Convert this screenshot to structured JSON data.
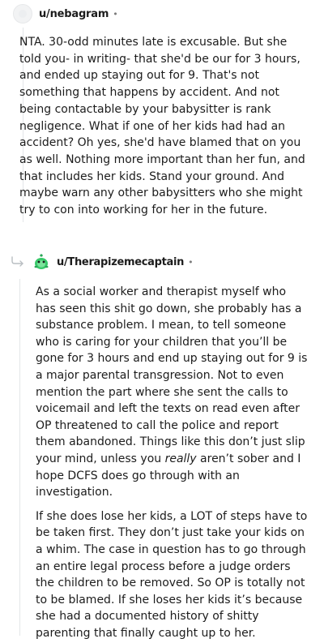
{
  "comment": {
    "username": "u/nebagram",
    "separator": "•",
    "avatar_icon": "snoo-avatar-placeholder",
    "body": "NTA. 30-odd minutes late is excusable. But she told you- in writing- that she'd be our for 3 hours, and ended up staying out for 9. That's not something that happens by accident. And not being contactable by your babysitter is rank negligence. What if one of her kids had had an accident? Oh yes, she'd have blamed that on you as well. Nothing more important than her fun, and that includes her kids. Stand your ground. And maybe warn any other babysitters who she might try to con into working for her in the future."
  },
  "reply": {
    "username": "u/Therapizemecaptain",
    "separator": "•",
    "reply_icon": "reply-arrow-icon",
    "avatar_icon": "green-snoo-avatar",
    "para1_before": "As a social worker and therapist myself who has seen this shit go down, she probably has a substance problem. I mean, to tell someone who is caring for your children that you’ll be gone for 3 hours and end up staying out for 9 is a major parental transgression. Not to even mention the part where she sent the calls to voicemail and left the texts on read even after OP threatened to call the police and report them abandoned. Things like this don’t just slip your mind, unless you ",
    "para1_em": "really",
    "para1_after": " aren’t sober and I hope DCFS does go through with an investigation.",
    "para2": "If she does lose her kids, a LOT of steps have to be taken first. They don’t just take your kids on a whim. The case in question has to go through an entire legal process before a judge orders the children to be removed. So OP is totally not to be blamed. If she loses her kids it’s because she had a documented history of shitty parenting that finally caught up to her."
  }
}
